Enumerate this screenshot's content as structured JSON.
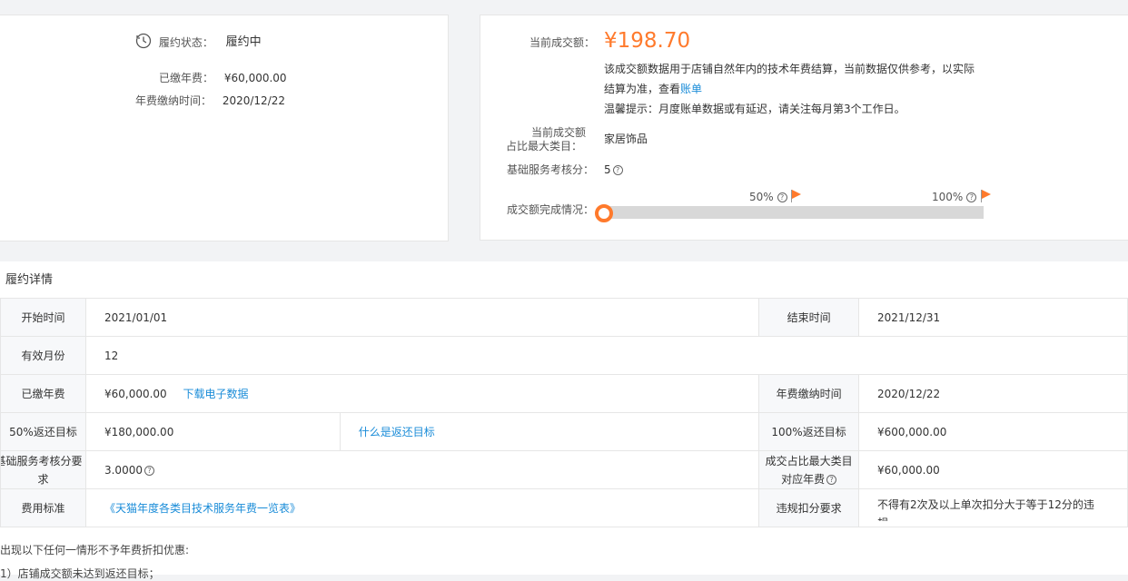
{
  "left_card": {
    "status_label": "履约状态：",
    "status_value": "履约中",
    "paid_fee_label": "已缴年费：",
    "paid_fee_value": "¥60,000.00",
    "paid_time_label": "年费缴纳时间：",
    "paid_time_value": "2020/12/22"
  },
  "right_card": {
    "amount_label": "当前成交额：",
    "amount_value": "¥198.70",
    "desc_line1": "该成交额数据用于店铺自然年内的技术年费结算，当前数据仅供参考，以实际",
    "desc_line2": "结算为准，查看",
    "desc_link": "账单",
    "tip": "温馨提示：月度账单数据或有延迟，请关注每月第3个工作日。",
    "category_label_1": "当前成交额",
    "category_label_2": "占比最大类目：",
    "category_value": "家居饰品",
    "score_label": "基础服务考核分：",
    "score_value": "5",
    "progress_label": "成交额完成情况：",
    "marker_50": "50%",
    "marker_100": "100%",
    "progress_fraction": 0.0
  },
  "detail": {
    "title": "履约详情",
    "rows": [
      {
        "k1": "开始时间",
        "v1": "2021/01/01",
        "k2": "结束时间",
        "v2": "2021/12/31"
      },
      {
        "k1": "有效月份",
        "v1": "12"
      },
      {
        "k1": "已缴年费",
        "v1": "¥60,000.00",
        "link1": "下载电子数据",
        "k2": "年费缴纳时间",
        "v2": "2020/12/22"
      },
      {
        "k1": "50%返还目标",
        "v1": "¥180,000.00",
        "link1": "什么是返还目标",
        "k2": "100%返还目标",
        "v2": "¥600,000.00"
      },
      {
        "k1a": "基础服务考核分要",
        "k1b": "求",
        "v1": "3.0000",
        "k2a": "成交占比最大类目",
        "k2b": "对应年费",
        "v2": "¥60,000.00"
      },
      {
        "k1": "费用标准",
        "link1": "《天猫年度各类目技术服务年费一览表》",
        "k2": "违规扣分要求",
        "v2": "不得有2次及以上单次扣分大于等于12分的违",
        "v2b": "规"
      }
    ],
    "note_1": "出现以下任何一情形不予年费折扣优惠:",
    "note_2": "1）店铺成交额未达到返还目标；"
  },
  "colors": {
    "accent": "#ff7a2c",
    "link": "#1a8cd8"
  }
}
